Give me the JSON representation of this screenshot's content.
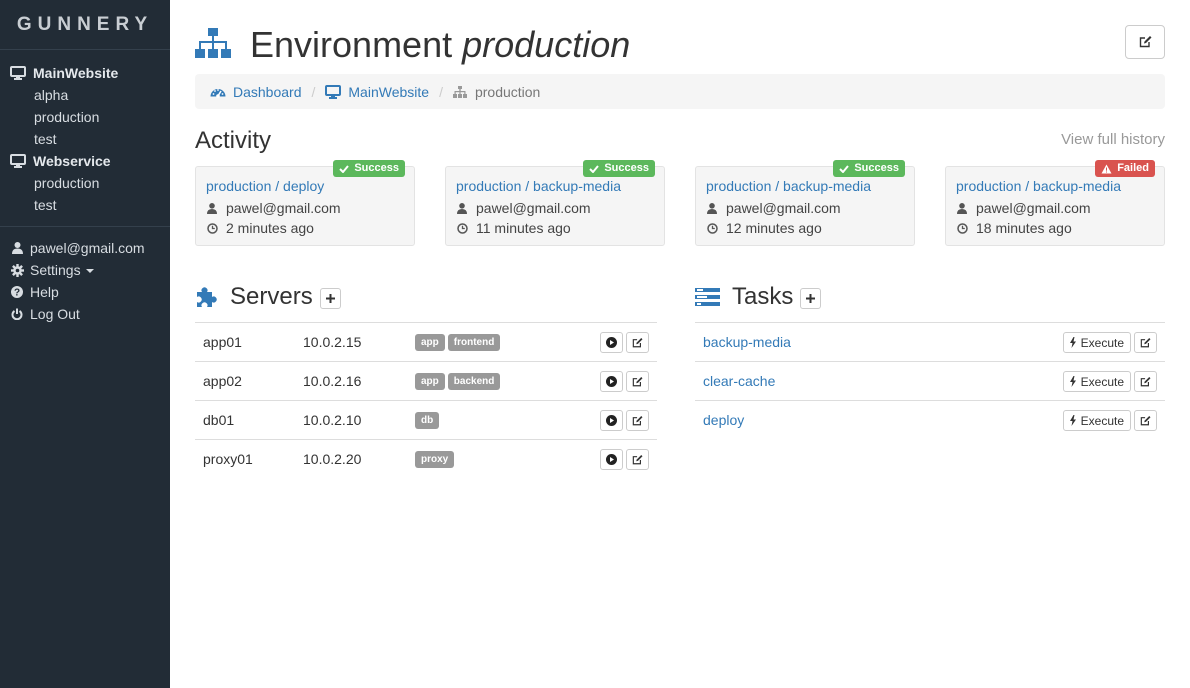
{
  "colors": {
    "sidebar_bg": "#222c36",
    "link": "#337ab7",
    "success": "#5cb85c",
    "failed": "#d9534f",
    "tag": "#999999"
  },
  "sidebar": {
    "brand": "GUNNERY",
    "applications": [
      {
        "name": "MainWebsite",
        "icon": "desktop-icon",
        "environments": [
          "alpha",
          "production",
          "test"
        ]
      },
      {
        "name": "Webservice",
        "icon": "desktop-icon",
        "environments": [
          "production",
          "test"
        ]
      }
    ],
    "user_email": "pawel@gmail.com",
    "settings_label": "Settings",
    "help_label": "Help",
    "logout_label": "Log Out"
  },
  "header": {
    "title_prefix": "Environment",
    "title_name": "production",
    "icon": "sitemap-icon"
  },
  "breadcrumb": {
    "dashboard": "Dashboard",
    "application": "MainWebsite",
    "environment": "production"
  },
  "activity": {
    "title": "Activity",
    "view_history": "View full history",
    "items": [
      {
        "title": "production / deploy",
        "user": "pawel@gmail.com",
        "time": "2 minutes ago",
        "status": "Success"
      },
      {
        "title": "production / backup-media",
        "user": "pawel@gmail.com",
        "time": "11 minutes ago",
        "status": "Success"
      },
      {
        "title": "production / backup-media",
        "user": "pawel@gmail.com",
        "time": "12 minutes ago",
        "status": "Success"
      },
      {
        "title": "production / backup-media",
        "user": "pawel@gmail.com",
        "time": "18 minutes ago",
        "status": "Failed"
      }
    ]
  },
  "servers": {
    "title": "Servers",
    "rows": [
      {
        "name": "app01",
        "ip": "10.0.2.15",
        "tags": [
          "app",
          "frontend"
        ]
      },
      {
        "name": "app02",
        "ip": "10.0.2.16",
        "tags": [
          "app",
          "backend"
        ]
      },
      {
        "name": "db01",
        "ip": "10.0.2.10",
        "tags": [
          "db"
        ]
      },
      {
        "name": "proxy01",
        "ip": "10.0.2.20",
        "tags": [
          "proxy"
        ]
      }
    ]
  },
  "tasks": {
    "title": "Tasks",
    "execute_label": "Execute",
    "rows": [
      {
        "name": "backup-media"
      },
      {
        "name": "clear-cache"
      },
      {
        "name": "deploy"
      }
    ]
  }
}
